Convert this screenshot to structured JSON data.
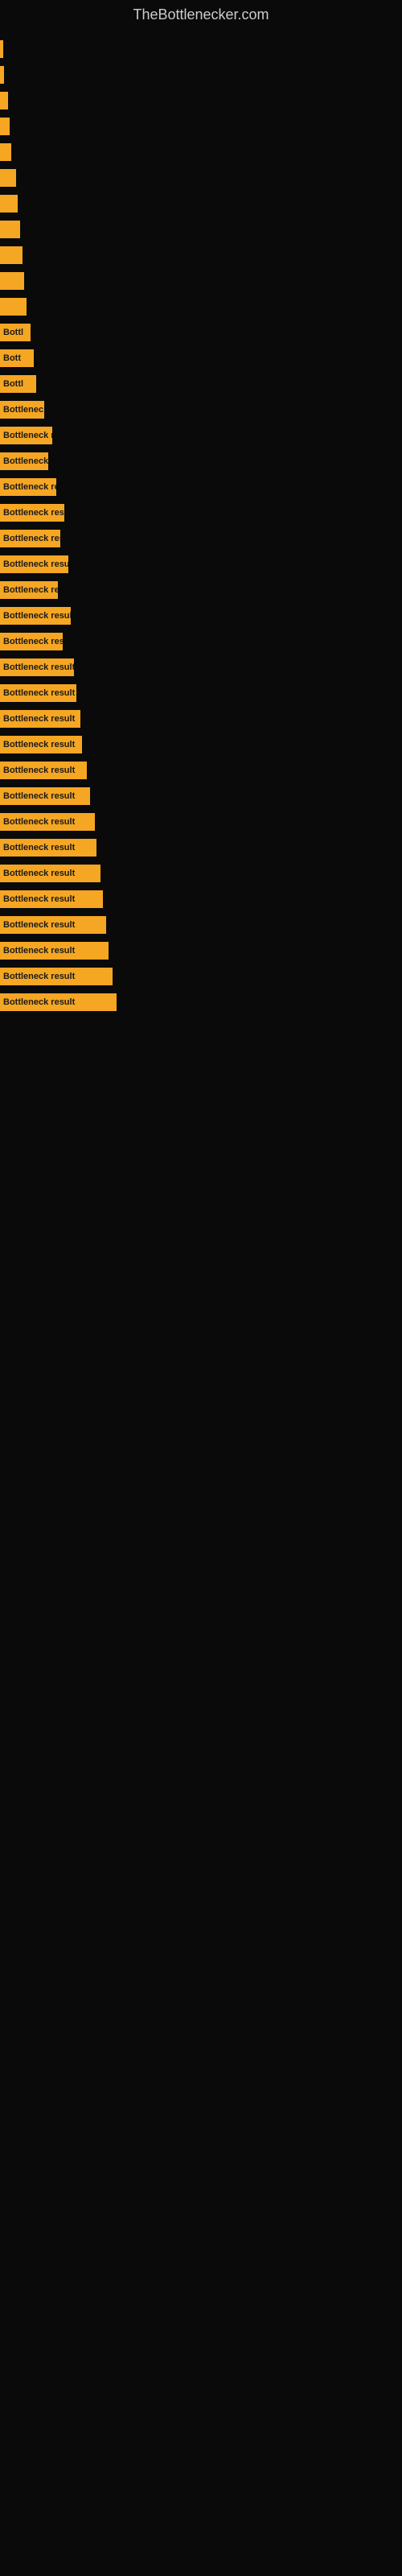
{
  "site_title": "TheBottlenecker.com",
  "bars": [
    {
      "label": "",
      "width": 4,
      "text": ""
    },
    {
      "label": "",
      "width": 5,
      "text": ""
    },
    {
      "label": "",
      "width": 10,
      "text": ""
    },
    {
      "label": "",
      "width": 12,
      "text": ""
    },
    {
      "label": "",
      "width": 14,
      "text": ""
    },
    {
      "label": "",
      "width": 20,
      "text": ""
    },
    {
      "label": "",
      "width": 22,
      "text": ""
    },
    {
      "label": "",
      "width": 25,
      "text": ""
    },
    {
      "label": "",
      "width": 28,
      "text": ""
    },
    {
      "label": "",
      "width": 30,
      "text": ""
    },
    {
      "label": "",
      "width": 33,
      "text": ""
    },
    {
      "label": "",
      "width": 38,
      "text": "Bottl"
    },
    {
      "label": "",
      "width": 42,
      "text": "Bott"
    },
    {
      "label": "",
      "width": 45,
      "text": "Bottl"
    },
    {
      "label": "",
      "width": 55,
      "text": "Bottlenec"
    },
    {
      "label": "",
      "width": 65,
      "text": "Bottleneck res"
    },
    {
      "label": "",
      "width": 60,
      "text": "Bottleneck"
    },
    {
      "label": "",
      "width": 70,
      "text": "Bottleneck resu"
    },
    {
      "label": "",
      "width": 80,
      "text": "Bottleneck result"
    },
    {
      "label": "",
      "width": 75,
      "text": "Bottleneck resu"
    },
    {
      "label": "",
      "width": 85,
      "text": "Bottleneck result"
    },
    {
      "label": "",
      "width": 72,
      "text": "Bottleneck re"
    },
    {
      "label": "",
      "width": 88,
      "text": "Bottleneck result"
    },
    {
      "label": "",
      "width": 78,
      "text": "Bottleneck resu"
    },
    {
      "label": "",
      "width": 92,
      "text": "Bottleneck result"
    },
    {
      "label": "",
      "width": 95,
      "text": "Bottleneck result"
    },
    {
      "label": "",
      "width": 100,
      "text": "Bottleneck result"
    },
    {
      "label": "",
      "width": 102,
      "text": "Bottleneck result"
    },
    {
      "label": "",
      "width": 108,
      "text": "Bottleneck result"
    },
    {
      "label": "",
      "width": 112,
      "text": "Bottleneck result"
    },
    {
      "label": "",
      "width": 118,
      "text": "Bottleneck result"
    },
    {
      "label": "",
      "width": 120,
      "text": "Bottleneck result"
    },
    {
      "label": "",
      "width": 125,
      "text": "Bottleneck result"
    },
    {
      "label": "",
      "width": 128,
      "text": "Bottleneck result"
    },
    {
      "label": "",
      "width": 132,
      "text": "Bottleneck result"
    },
    {
      "label": "",
      "width": 135,
      "text": "Bottleneck result"
    },
    {
      "label": "",
      "width": 140,
      "text": "Bottleneck result"
    },
    {
      "label": "",
      "width": 145,
      "text": "Bottleneck result"
    }
  ]
}
